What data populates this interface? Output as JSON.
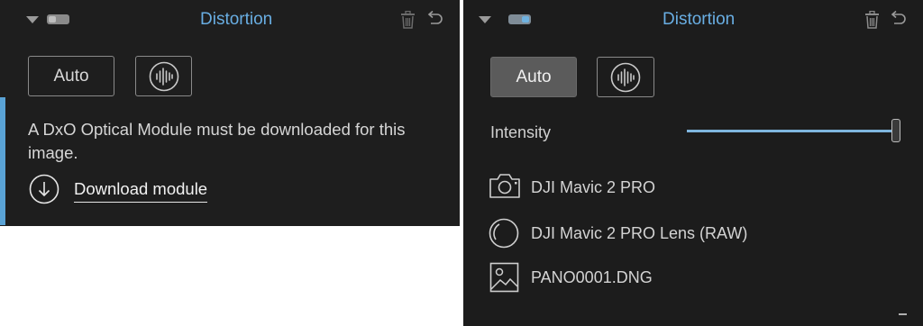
{
  "left_panel": {
    "title": "Distortion",
    "auto_label": "Auto",
    "message": "A DxO Optical Module must be downloaded for this image.",
    "download_label": "Download module"
  },
  "right_panel": {
    "title": "Distortion",
    "auto_label": "Auto",
    "intensity_label": "Intensity",
    "intensity_value": 1.0,
    "camera": "DJI Mavic 2 PRO",
    "lens": "DJI Mavic 2 PRO Lens (RAW)",
    "file": "PANO0001.DNG"
  },
  "colors": {
    "accent_blue": "#69aee3",
    "panel_bg": "#1e1e1e",
    "slider": "#7fb6de"
  },
  "icons": [
    "collapse-arrow-icon",
    "toggle-icon",
    "trash-icon",
    "undo-icon",
    "waveform-icon",
    "download-icon",
    "camera-icon",
    "lens-icon",
    "image-icon",
    "minus-icon"
  ]
}
